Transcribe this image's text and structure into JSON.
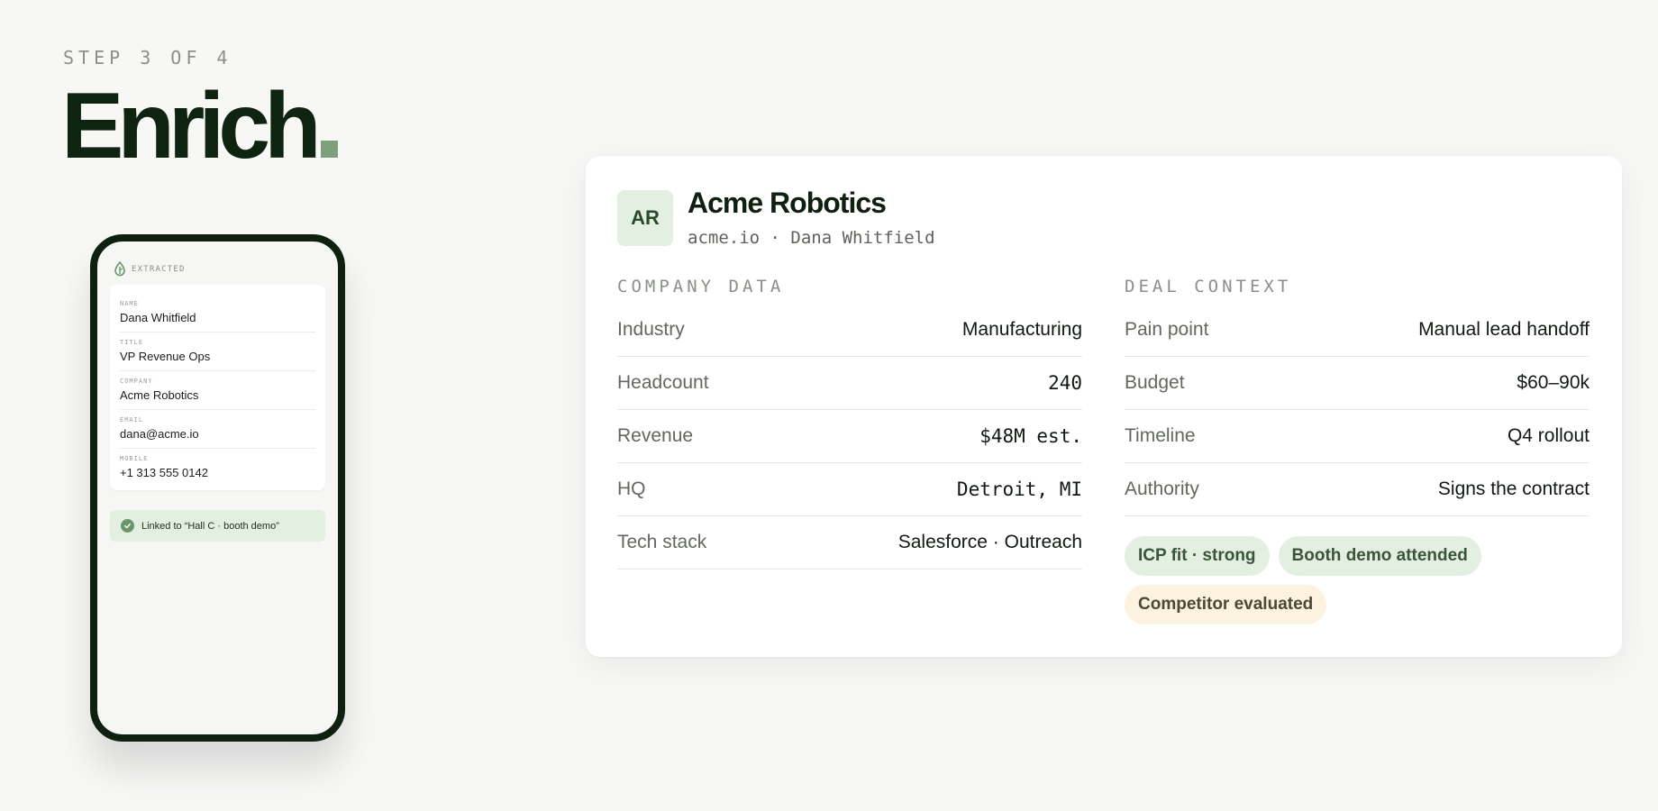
{
  "header": {
    "step": "STEP 3 OF 4",
    "title": "Enrich"
  },
  "phone": {
    "status_label": "EXTRACTED",
    "fields": [
      {
        "label": "NAME",
        "value": "Dana Whitfield"
      },
      {
        "label": "TITLE",
        "value": "VP Revenue Ops"
      },
      {
        "label": "COMPANY",
        "value": "Acme Robotics"
      },
      {
        "label": "EMAIL",
        "value": "dana@acme.io"
      },
      {
        "label": "MOBILE",
        "value": "+1 313 555 0142"
      }
    ],
    "link_text": "Linked to “Hall C · booth demo”"
  },
  "company": {
    "initials": "AR",
    "name": "Acme Robotics",
    "subtitle": "acme.io · Dana Whitfield"
  },
  "company_data": {
    "title": "COMPANY DATA",
    "rows": [
      {
        "key": "Industry",
        "value": "Manufacturing"
      },
      {
        "key": "Headcount",
        "value": "240"
      },
      {
        "key": "Revenue",
        "value": "$48M est."
      },
      {
        "key": "HQ",
        "value": "Detroit, MI"
      },
      {
        "key": "Tech stack",
        "value": "Salesforce · Outreach"
      }
    ]
  },
  "deal_context": {
    "title": "DEAL CONTEXT",
    "rows": [
      {
        "key": "Pain point",
        "value": "Manual lead handoff"
      },
      {
        "key": "Budget",
        "value": "$60–90k"
      },
      {
        "key": "Timeline",
        "value": "Q4 rollout"
      },
      {
        "key": "Authority",
        "value": "Signs the contract"
      }
    ],
    "tags": [
      {
        "label": "ICP fit · strong",
        "tone": "green"
      },
      {
        "label": "Booth demo attended",
        "tone": "green"
      },
      {
        "label": "Competitor evaluated",
        "tone": "amber"
      }
    ]
  },
  "colors": {
    "brand_dark": "#0f2410",
    "accent_green": "#7fa07c",
    "tag_green_bg": "#e3f0e1",
    "tag_amber_bg": "#fbf2df"
  }
}
